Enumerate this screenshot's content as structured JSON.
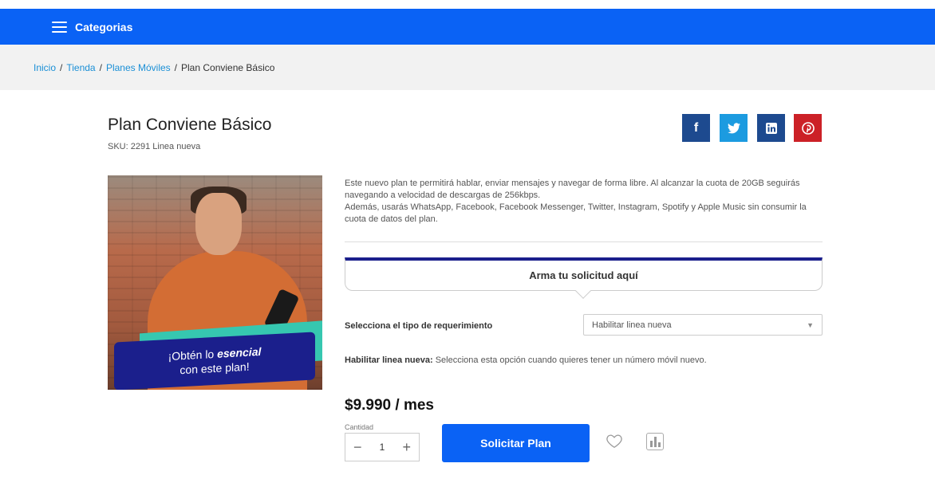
{
  "topbar": {
    "categories_label": "Categorias",
    "background": "#0a62f5"
  },
  "breadcrumb": {
    "items": [
      "Inicio",
      "Tienda",
      "Planes Móviles"
    ],
    "current": "Plan Conviene Básico",
    "separator": "/"
  },
  "product": {
    "title": "Plan Conviene Básico",
    "sku": "SKU: 2291 Linea nueva",
    "promo_line1": "¡Obtén lo ",
    "promo_emphasis": "esencial",
    "promo_line2": "con este plan!",
    "description": [
      "Este nuevo plan te permitirá hablar, enviar mensajes y navegar de forma libre. Al alcanzar la cuota de 20GB seguirás navegando a velocidad de descargas de 256kbps.",
      "Además, usarás WhatsApp, Facebook, Facebook Messenger, Twitter, Instagram, Spotify y Apple Music sin consumir la cuota de datos del plan."
    ],
    "price": "$9.990  / mes"
  },
  "share": {
    "facebook_icon": "f",
    "twitter_icon": "twitter-bird",
    "linkedin_icon": "in",
    "pinterest_icon": "pinterest-p",
    "colors": {
      "facebook": "#1d4a8f",
      "twitter": "#1c9be0",
      "linkedin": "#1d4a8f",
      "pinterest": "#cc2127"
    }
  },
  "form": {
    "heading": "Arma tu solicitud aquí",
    "requirement_label": "Selecciona el tipo de requerimiento",
    "requirement_value": "Habilitar linea nueva",
    "help_bold": "Habilitar linea nueva:",
    "help_text": " Selecciona esta opción cuando quieres tener un número móvil nuevo.",
    "quantity_label": "Cantidad",
    "quantity_value": "1",
    "submit_label": "Solicitar Plan"
  }
}
